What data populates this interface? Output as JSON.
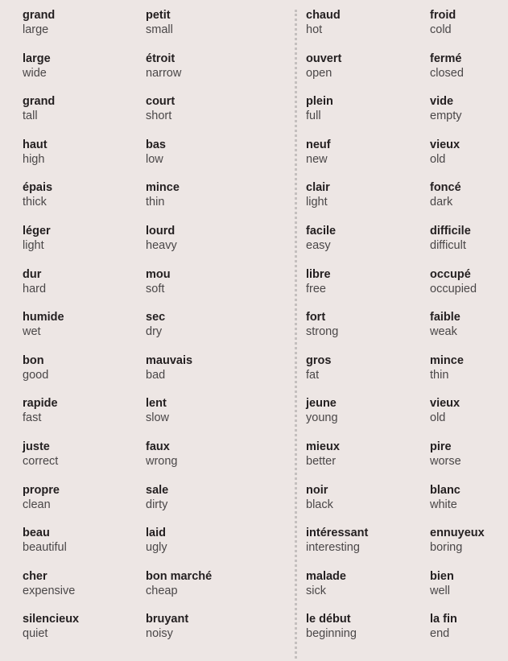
{
  "columns": [
    {
      "id": "col-1",
      "pairs": [
        {
          "fr": "grand",
          "en": "large"
        },
        {
          "fr": "large",
          "en": "wide"
        },
        {
          "fr": "grand",
          "en": "tall"
        },
        {
          "fr": "haut",
          "en": "high"
        },
        {
          "fr": "épais",
          "en": "thick"
        },
        {
          "fr": "léger",
          "en": "light"
        },
        {
          "fr": "dur",
          "en": "hard"
        },
        {
          "fr": "humide",
          "en": "wet"
        },
        {
          "fr": "bon",
          "en": "good"
        },
        {
          "fr": "rapide",
          "en": "fast"
        },
        {
          "fr": "juste",
          "en": "correct"
        },
        {
          "fr": "propre",
          "en": "clean"
        },
        {
          "fr": "beau",
          "en": "beautiful"
        },
        {
          "fr": "cher",
          "en": "expensive"
        },
        {
          "fr": "silencieux",
          "en": "quiet"
        }
      ]
    },
    {
      "id": "col-2",
      "pairs": [
        {
          "fr": "petit",
          "en": "small"
        },
        {
          "fr": "étroit",
          "en": "narrow"
        },
        {
          "fr": "court",
          "en": "short"
        },
        {
          "fr": "bas",
          "en": "low"
        },
        {
          "fr": "mince",
          "en": "thin"
        },
        {
          "fr": "lourd",
          "en": "heavy"
        },
        {
          "fr": "mou",
          "en": "soft"
        },
        {
          "fr": "sec",
          "en": "dry"
        },
        {
          "fr": "mauvais",
          "en": "bad"
        },
        {
          "fr": "lent",
          "en": "slow"
        },
        {
          "fr": "faux",
          "en": "wrong"
        },
        {
          "fr": "sale",
          "en": "dirty"
        },
        {
          "fr": "laid",
          "en": "ugly"
        },
        {
          "fr": "bon marché",
          "en": "cheap"
        },
        {
          "fr": "bruyant",
          "en": "noisy"
        }
      ]
    },
    {
      "id": "col-3",
      "pairs": [
        {
          "fr": "chaud",
          "en": "hot"
        },
        {
          "fr": "ouvert",
          "en": "open"
        },
        {
          "fr": "plein",
          "en": "full"
        },
        {
          "fr": "neuf",
          "en": "new"
        },
        {
          "fr": "clair",
          "en": "light"
        },
        {
          "fr": "facile",
          "en": "easy"
        },
        {
          "fr": "libre",
          "en": "free"
        },
        {
          "fr": "fort",
          "en": "strong"
        },
        {
          "fr": "gros",
          "en": "fat"
        },
        {
          "fr": "jeune",
          "en": "young"
        },
        {
          "fr": "mieux",
          "en": "better"
        },
        {
          "fr": "noir",
          "en": "black"
        },
        {
          "fr": "intéressant",
          "en": "interesting"
        },
        {
          "fr": "malade",
          "en": "sick"
        },
        {
          "fr": "le début",
          "en": "beginning"
        }
      ]
    },
    {
      "id": "col-4",
      "pairs": [
        {
          "fr": "froid",
          "en": "cold"
        },
        {
          "fr": "fermé",
          "en": "closed"
        },
        {
          "fr": "vide",
          "en": "empty"
        },
        {
          "fr": "vieux",
          "en": "old"
        },
        {
          "fr": "foncé",
          "en": "dark"
        },
        {
          "fr": "difficile",
          "en": "difficult"
        },
        {
          "fr": "occupé",
          "en": "occupied"
        },
        {
          "fr": "faible",
          "en": "weak"
        },
        {
          "fr": "mince",
          "en": "thin"
        },
        {
          "fr": "vieux",
          "en": "old"
        },
        {
          "fr": "pire",
          "en": "worse"
        },
        {
          "fr": "blanc",
          "en": "white"
        },
        {
          "fr": "ennuyeux",
          "en": "boring"
        },
        {
          "fr": "bien",
          "en": "well"
        },
        {
          "fr": "la fin",
          "en": "end"
        }
      ]
    }
  ],
  "colors": {
    "background": "#ede6e4",
    "french_text": "#231f20",
    "english_text": "#4a4748",
    "divider": "#c4bfbe"
  }
}
